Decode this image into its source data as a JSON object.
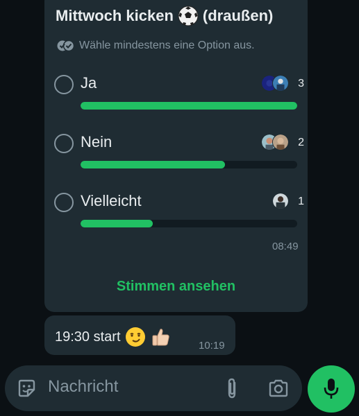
{
  "poll": {
    "title": "Mittwoch kicken",
    "title_suffix": "(draußen)",
    "title_emoji": "soccer-ball-emoji",
    "hint": "Wähle mindestens eine Option aus.",
    "time": "08:49",
    "view_votes": "Stimmen ansehen",
    "options": [
      {
        "label": "Ja",
        "votes": "3",
        "fraction": 1.0
      },
      {
        "label": "Nein",
        "votes": "2",
        "fraction": 0.667
      },
      {
        "label": "Vielleicht",
        "votes": "1",
        "fraction": 0.333
      }
    ]
  },
  "message": {
    "text": "19:30 start",
    "emojis": [
      "smirking-face-emoji",
      "thumbs-up-emoji"
    ],
    "time": "10:19"
  },
  "composer": {
    "placeholder": "Nachricht",
    "icons": [
      "sticker-icon",
      "paperclip-icon",
      "camera-icon",
      "microphone-icon"
    ]
  },
  "colors": {
    "accent": "#21c063",
    "bubble": "#1f2c33",
    "background": "#0b1014",
    "muted": "#8696a0"
  }
}
